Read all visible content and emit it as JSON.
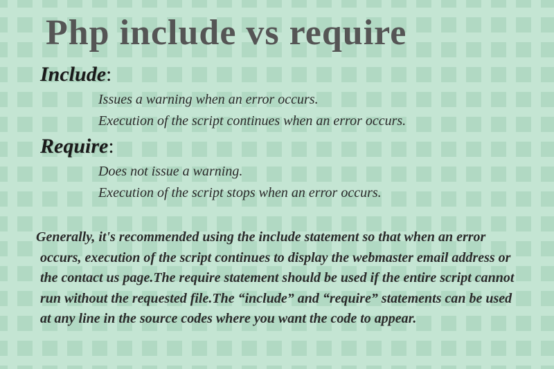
{
  "title": "Php include vs require",
  "include": {
    "label": "Include",
    "points": {
      "p1": "Issues a warning when an error occurs.",
      "p2": "Execution of the script continues when an error occurs."
    }
  },
  "require": {
    "label": "Require",
    "points": {
      "p1": "Does not issue a warning.",
      "p2": "Execution of the script stops when an error occurs."
    }
  },
  "summary": " Generally, it's recommended using the include statement so that when an error occurs, execution of the script continues to display the webmaster email address or the contact us page.The require statement should be used if the entire script cannot run without the requested file.The “include” and “require” statements can be used at any line in the source codes where you want the code to appear."
}
